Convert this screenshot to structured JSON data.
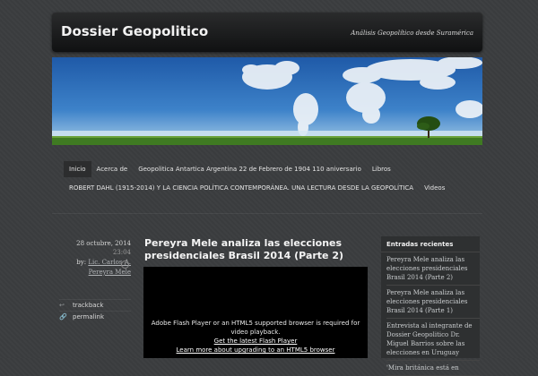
{
  "header": {
    "title": "Dossier Geopolitico",
    "description": "Análisis Geopolítico desde Suramérica"
  },
  "nav": {
    "row1": [
      "Inicio",
      "Acerca de",
      "Geopolitica Antartica Argentina 22 de Febrero de 1904 110 aniversario",
      "Libros"
    ],
    "row2": [
      "ROBERT DAHL (1915-2014) Y LA CIENCIA POLÍTICA CONTEMPORÁNEA. UNA LECTURA DESDE LA GEOPOLÍTICA",
      "Videos"
    ]
  },
  "post": {
    "date": "28 octubre, 2014",
    "time": "23:04",
    "by_prefix": "by:",
    "author": "Lic. Carlos A. Pereyra Mele",
    "title": "Pereyra Mele analiza las elecciones presidenciales Brasil 2014 (Parte 2)",
    "links": [
      {
        "icon": "trackback-icon",
        "label": "trackback"
      },
      {
        "icon": "link-icon",
        "label": "permalink"
      }
    ],
    "flash_message": "Adobe Flash Player or an HTML5 supported browser is required for video playback.",
    "flash_link1": "Get the latest Flash Player",
    "flash_link2": "Learn more about upgrading to an HTML5 browser"
  },
  "sidebar": {
    "heading": "Entradas recientes",
    "items": [
      "Pereyra Mele analiza las elecciones presidenciales Brasil 2014 (Parte 2)",
      "Pereyra Mele analiza las elecciones presidenciales Brasil 2014 (Parte 1)",
      "Entrevista al integrante de Dossier Geopolitico Dr. Miguel Barrios sobre las elecciones en Uruguay",
      "'Mira británica está en"
    ]
  },
  "colors": {
    "background": "#3b3d3f",
    "header": "#141516",
    "sky": "#2f6fb8",
    "grass": "#4f8a2a"
  }
}
